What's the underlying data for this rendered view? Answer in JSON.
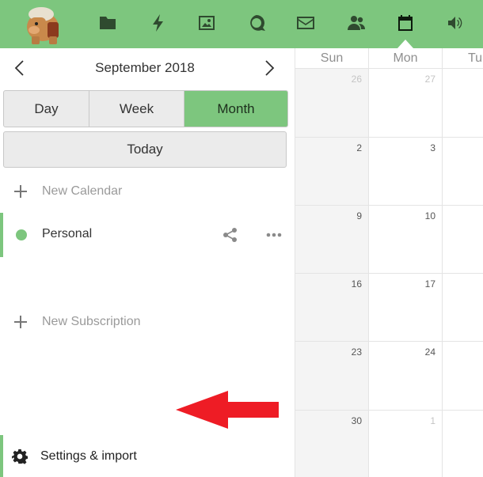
{
  "header": {
    "logo": "app-logo",
    "apps": [
      {
        "name": "files-icon"
      },
      {
        "name": "activity-icon"
      },
      {
        "name": "gallery-icon"
      },
      {
        "name": "talk-icon"
      },
      {
        "name": "mail-icon"
      },
      {
        "name": "contacts-icon"
      },
      {
        "name": "calendar-icon",
        "active": true
      },
      {
        "name": "audio-icon"
      }
    ],
    "colors": {
      "bar": "#7dc67e",
      "icon": "#2f4a2f"
    }
  },
  "sidebar": {
    "month_label": "September 2018",
    "views": [
      {
        "label": "Day",
        "active": false
      },
      {
        "label": "Week",
        "active": false
      },
      {
        "label": "Month",
        "active": true
      }
    ],
    "today_label": "Today",
    "new_calendar_label": "New Calendar",
    "calendars": [
      {
        "label": "Personal",
        "color": "#7dc67e"
      }
    ],
    "new_subscription_label": "New Subscription",
    "settings_label": "Settings & import",
    "annotation_arrow_color": "#ee1c25"
  },
  "calendar": {
    "columns": [
      "Sun",
      "Mon",
      "Tu"
    ],
    "weeks": [
      [
        "26",
        "27",
        ""
      ],
      [
        "2",
        "3",
        ""
      ],
      [
        "9",
        "10",
        ""
      ],
      [
        "16",
        "17",
        ""
      ],
      [
        "23",
        "24",
        ""
      ],
      [
        "30",
        "1",
        ""
      ]
    ],
    "other_month_days": [
      "26",
      "27",
      "1"
    ]
  }
}
